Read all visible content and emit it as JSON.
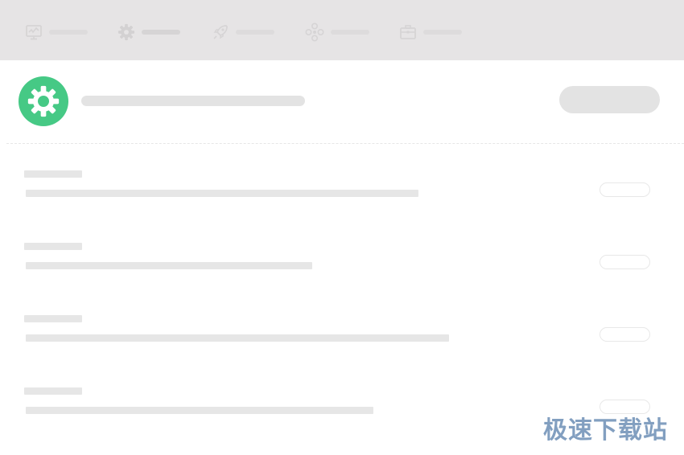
{
  "window": {
    "background": "#ffffff",
    "accent": "#46c985",
    "topbar_color": "#e6e4e5"
  },
  "tabs": [
    {
      "icon": "monitor-icon",
      "label": ""
    },
    {
      "icon": "gear-icon",
      "label": ""
    },
    {
      "icon": "rocket-icon",
      "label": ""
    },
    {
      "icon": "nodes-icon",
      "label": ""
    },
    {
      "icon": "toolbox-icon",
      "label": ""
    }
  ],
  "header": {
    "icon": "gear-icon",
    "title": "",
    "button_label": ""
  },
  "settings": [
    {
      "title": "",
      "description": "",
      "toggle_label": ""
    },
    {
      "title": "",
      "description": "",
      "toggle_label": ""
    },
    {
      "title": "",
      "description": "",
      "toggle_label": ""
    },
    {
      "title": "",
      "description": "",
      "toggle_label": ""
    }
  ],
  "watermark": {
    "text": "极速下载站"
  }
}
